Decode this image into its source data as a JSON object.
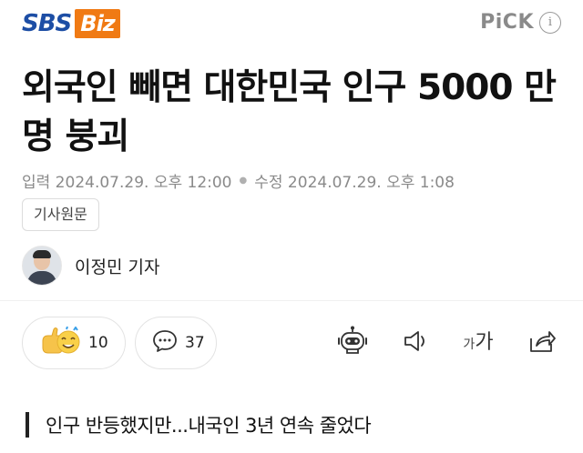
{
  "header": {
    "logo_sbs": "SBS",
    "logo_biz": "Biz",
    "pick_label": "PiCK",
    "pick_info": "i"
  },
  "article": {
    "title": "외국인 빼면 대한민국 인구 5000 만명 붕괴",
    "published": "입력 2024.07.29. 오후 12:00",
    "modified": "수정 2024.07.29. 오후 1:08",
    "origin_button": "기사원문",
    "reporter": "이정민 기자",
    "subheading": "인구 반등했지만...내국인 3년 연속 줄었다"
  },
  "reactions": {
    "like_count": "10",
    "comment_count": "37"
  },
  "toolbar": {
    "font_small": "가",
    "font_large": "가"
  },
  "colors": {
    "sbs_blue": "#1d4ea5",
    "biz_orange": "#f07a14",
    "meta_gray": "#8a8a8a"
  }
}
